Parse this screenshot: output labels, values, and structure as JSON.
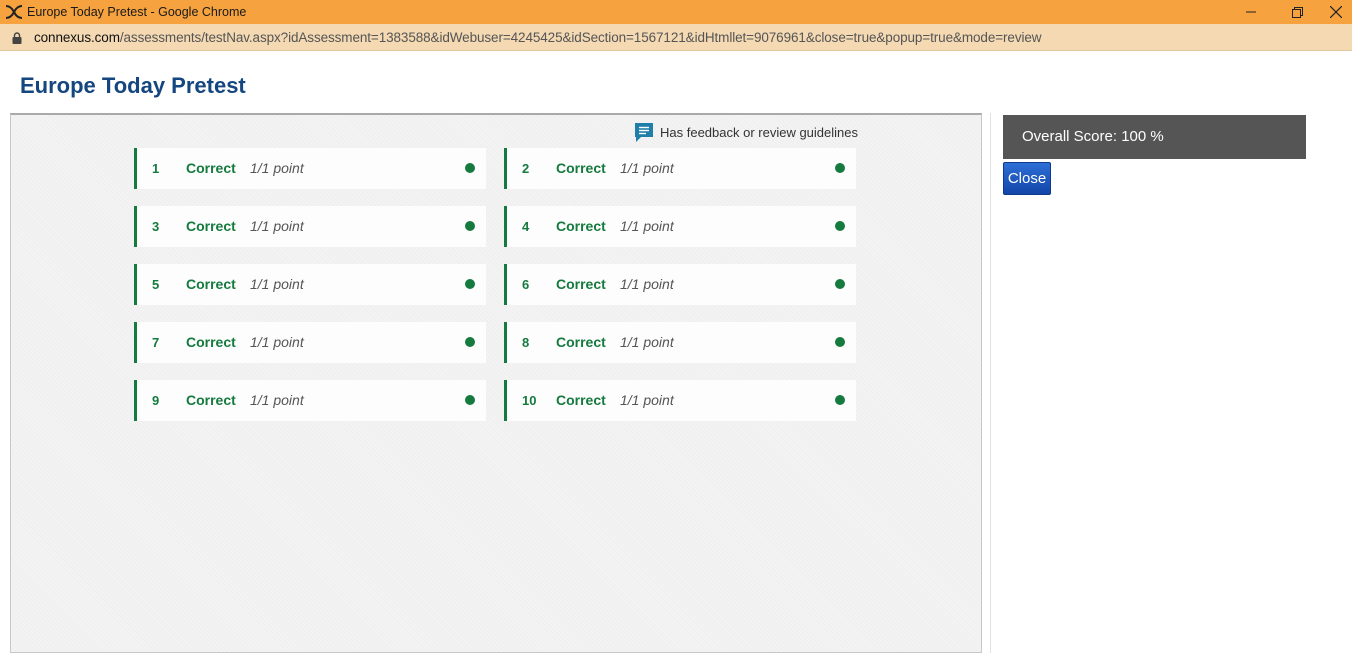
{
  "window": {
    "title": "Europe Today Pretest - Google Chrome",
    "minimize_icon": "minimize-icon",
    "restore_icon": "restore-icon",
    "close_icon": "close-icon"
  },
  "address": {
    "domain": "connexus.com",
    "path": "/assessments/testNav.aspx?idAssessment=1383588&idWebuser=4245425&idSection=1567121&idHtmllet=9076961&close=true&popup=true&mode=review"
  },
  "page": {
    "title": "Europe Today Pretest"
  },
  "legend": {
    "icon": "feedback-icon",
    "text": "Has feedback or review guidelines"
  },
  "questions": [
    {
      "number": "1",
      "status": "Correct",
      "points": "1/1 point"
    },
    {
      "number": "2",
      "status": "Correct",
      "points": "1/1 point"
    },
    {
      "number": "3",
      "status": "Correct",
      "points": "1/1 point"
    },
    {
      "number": "4",
      "status": "Correct",
      "points": "1/1 point"
    },
    {
      "number": "5",
      "status": "Correct",
      "points": "1/1 point"
    },
    {
      "number": "6",
      "status": "Correct",
      "points": "1/1 point"
    },
    {
      "number": "7",
      "status": "Correct",
      "points": "1/1 point"
    },
    {
      "number": "8",
      "status": "Correct",
      "points": "1/1 point"
    },
    {
      "number": "9",
      "status": "Correct",
      "points": "1/1 point"
    },
    {
      "number": "10",
      "status": "Correct",
      "points": "1/1 point"
    }
  ],
  "sidebar": {
    "score_text": "Overall Score: 100 %",
    "close_label": "Close"
  },
  "colors": {
    "titlebar": "#f5a23f",
    "addressbar": "#f4d9b3",
    "title_blue": "#14467f",
    "correct_green": "#157a3e",
    "score_bg": "#555555",
    "button_blue": "#1a56c4"
  }
}
